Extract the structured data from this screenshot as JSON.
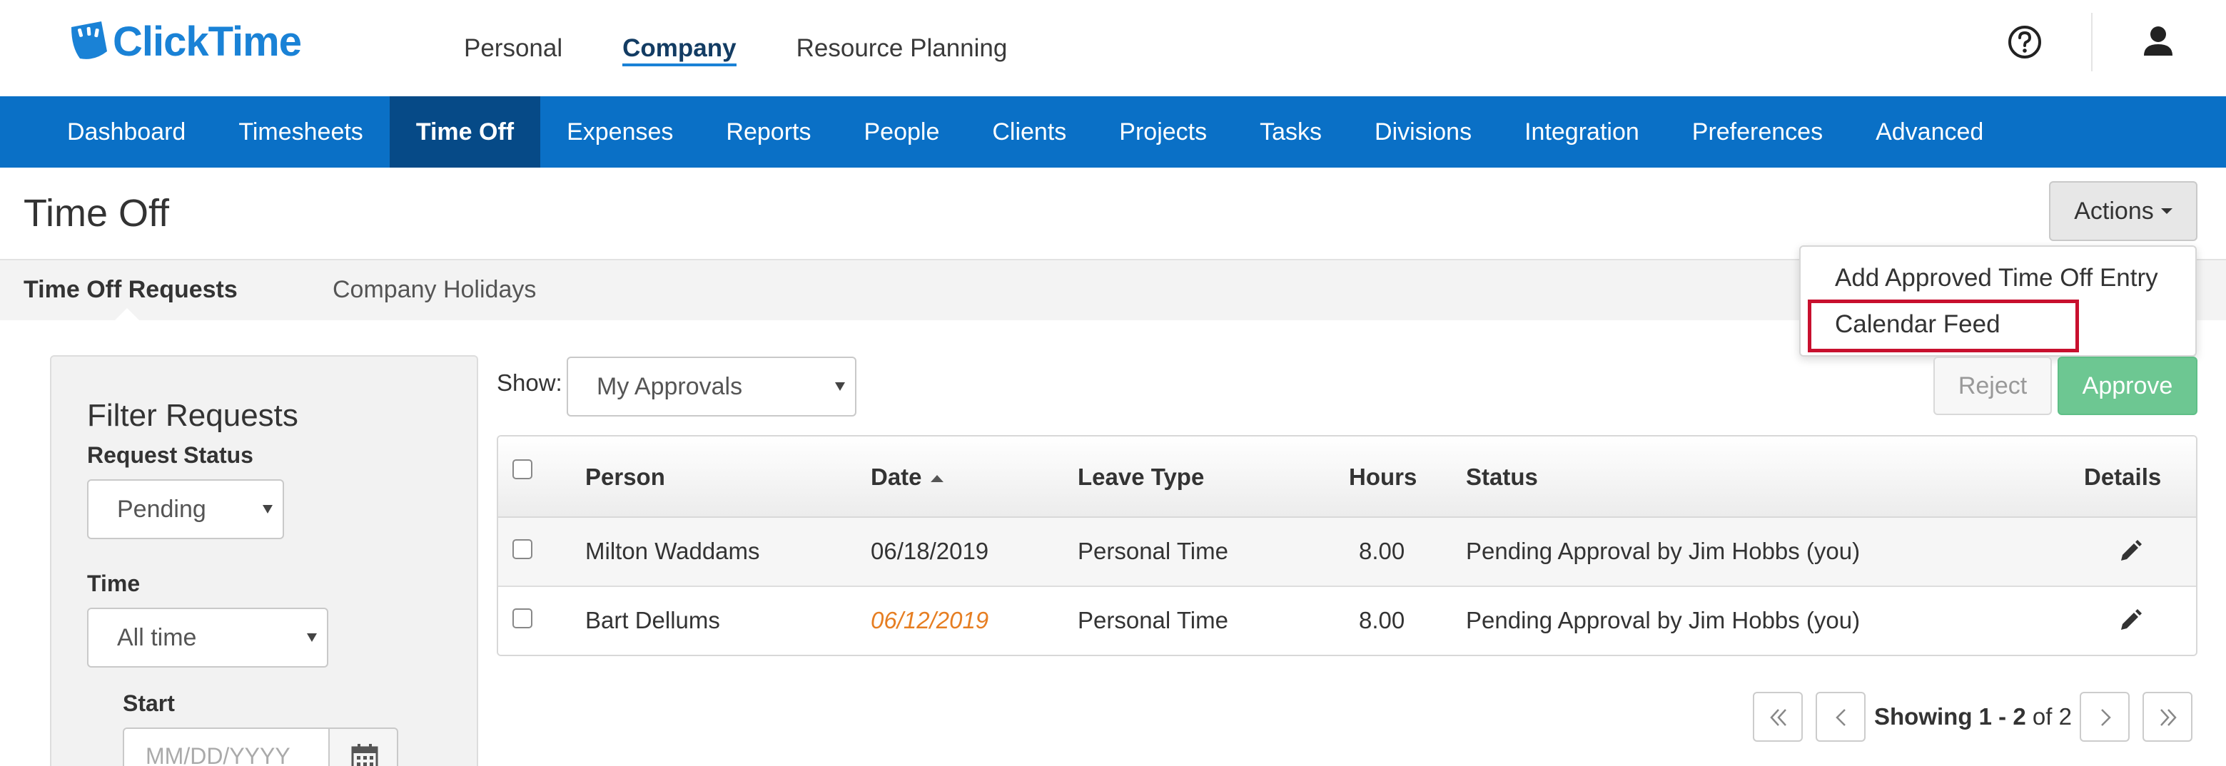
{
  "app": {
    "logo_text": "ClickTime"
  },
  "topnav": {
    "items": [
      {
        "label": "Personal",
        "active": false
      },
      {
        "label": "Company",
        "active": true
      },
      {
        "label": "Resource Planning",
        "active": false
      }
    ]
  },
  "mainnav": {
    "items": [
      {
        "label": "Dashboard"
      },
      {
        "label": "Timesheets"
      },
      {
        "label": "Time Off"
      },
      {
        "label": "Expenses"
      },
      {
        "label": "Reports"
      },
      {
        "label": "People"
      },
      {
        "label": "Clients"
      },
      {
        "label": "Projects"
      },
      {
        "label": "Tasks"
      },
      {
        "label": "Divisions"
      },
      {
        "label": "Integration"
      },
      {
        "label": "Preferences"
      },
      {
        "label": "Advanced"
      }
    ],
    "active_label": "Time Off"
  },
  "page": {
    "title": "Time Off",
    "actions_label": "Actions"
  },
  "subtabs": {
    "requests": "Time Off Requests",
    "holidays": "Company Holidays"
  },
  "actions_menu": {
    "items": [
      "Add Approved Time Off Entry",
      "Calendar Feed"
    ],
    "highlighted": "Calendar Feed",
    "highlight_color": "#c8102e"
  },
  "filter": {
    "title": "Filter Requests",
    "status_label": "Request Status",
    "status_value": "Pending",
    "time_label": "Time",
    "time_value": "All time",
    "start_label": "Start",
    "start_placeholder": "MM/DD/YYYY"
  },
  "toolbar": {
    "show_label": "Show:",
    "show_value": "My Approvals",
    "reject_label": "Reject",
    "approve_label": "Approve"
  },
  "table": {
    "columns": [
      "Person",
      "Date",
      "Leave Type",
      "Hours",
      "Status",
      "Details"
    ],
    "rows": [
      {
        "person": "Milton Waddams",
        "date": "06/18/2019",
        "leave_type": "Personal Time",
        "hours": "8.00",
        "status": "Pending Approval by Jim Hobbs (you)"
      },
      {
        "person": "Bart Dellums",
        "date": "06/12/2019",
        "leave_type": "Personal Time",
        "hours": "8.00",
        "status": "Pending Approval by Jim Hobbs (you)"
      }
    ]
  },
  "pagination": {
    "showing_prefix": "Showing",
    "range": "1 - 2",
    "of_text": "of 2"
  },
  "colors": {
    "brand_blue": "#0a70c6",
    "active_nav": "#064a87",
    "approve_green": "#6dc792",
    "warning_date": "#e67e22"
  },
  "icons": [
    "logo-icon",
    "help-icon",
    "user-icon",
    "calendar-icon",
    "pencil-icon",
    "first-page-icon",
    "prev-page-icon",
    "next-page-icon",
    "last-page-icon"
  ]
}
